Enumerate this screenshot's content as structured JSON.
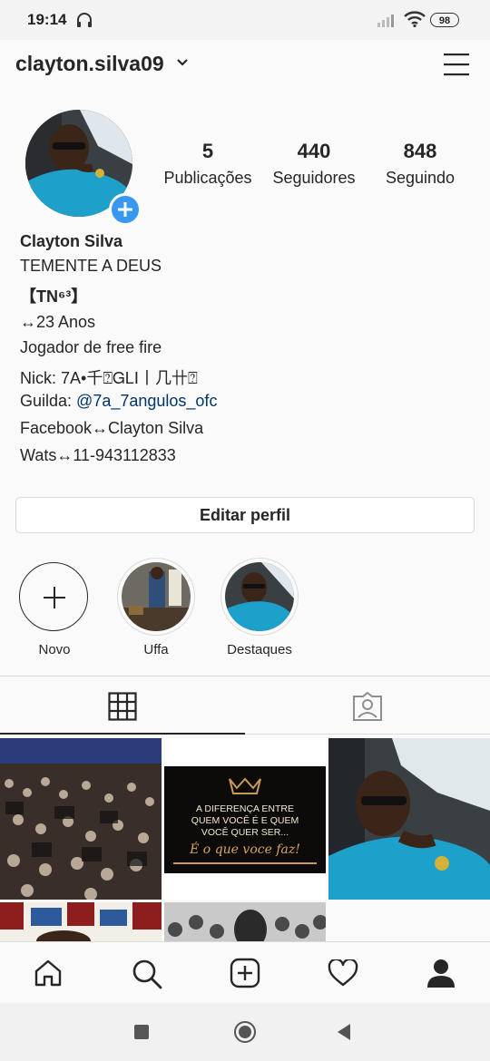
{
  "status_bar": {
    "time": "19:14",
    "battery": "98"
  },
  "header": {
    "username": "clayton.silva09"
  },
  "stats": [
    {
      "value": "5",
      "label": "Publicações"
    },
    {
      "value": "440",
      "label": "Seguidores"
    },
    {
      "value": "848",
      "label": "Seguindo"
    }
  ],
  "bio": {
    "name": "Clayton Silva",
    "line1": "TEMENTE A DEUS",
    "line2": "【TN⁶³】",
    "line3": "↔23 Anos",
    "line4": "Jogador de free fire",
    "line5": "Nick: 7A•千⍰ᏀLⅠ丨几卄⍰",
    "guild_prefix": "Guilda: ",
    "guild_link": "@7a_7angulos_ofc",
    "line7": "Facebook↔Clayton Silva",
    "line8": "Wats↔11-943112833"
  },
  "edit_profile_label": "Editar perfil",
  "highlights": [
    {
      "label": "Novo"
    },
    {
      "label": "Uffa"
    },
    {
      "label": "Destaques"
    }
  ],
  "post_quote": {
    "line1": "A DIFERENÇA ENTRE",
    "line2": "QUEM VOCÊ É E QUEM",
    "line3": "VOCÊ QUER SER...",
    "line4": "É o que voce faz!"
  },
  "colors": {
    "accent": "#3897f0",
    "link": "#003569",
    "text": "#262626"
  },
  "icons": [
    "home-icon",
    "search-icon",
    "new-post-icon",
    "heart-icon",
    "profile-icon",
    "grid-icon",
    "tagged-icon",
    "menu-icon"
  ]
}
